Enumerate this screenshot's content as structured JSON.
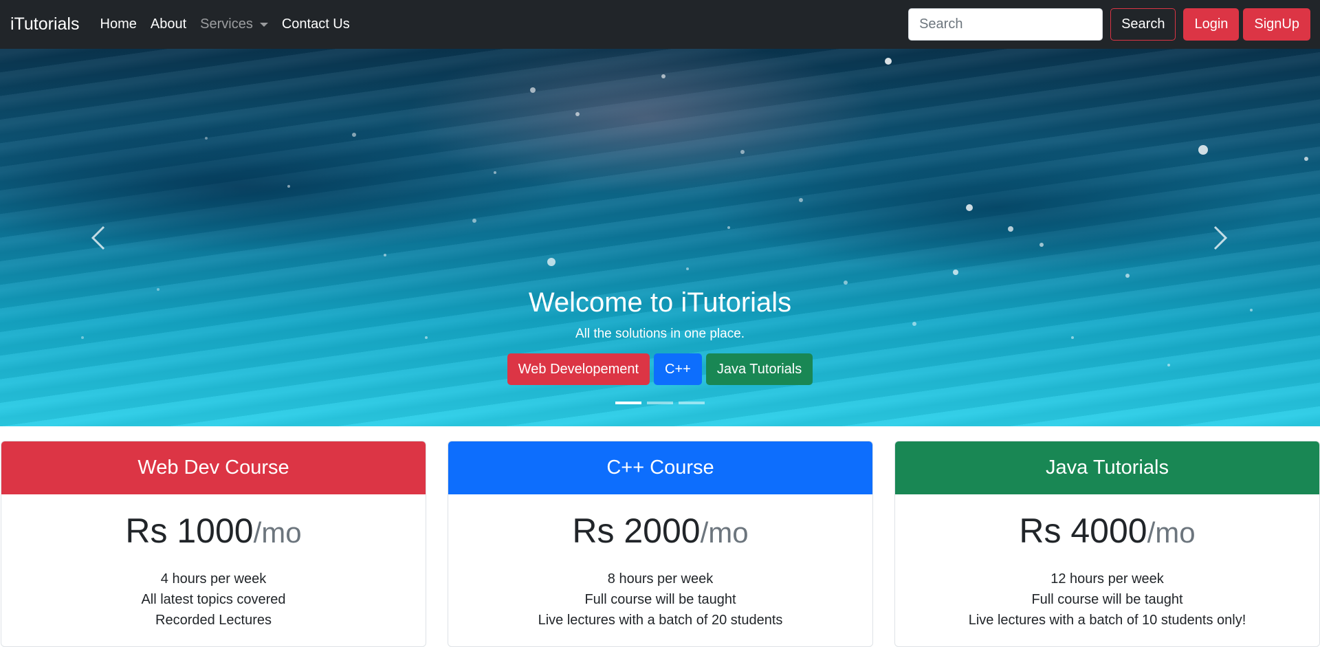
{
  "navbar": {
    "brand": "iTutorials",
    "links": [
      "Home",
      "About",
      "Services",
      "Contact Us"
    ],
    "search_placeholder": "Search",
    "search_button": "Search",
    "login_button": "Login",
    "signup_button": "SignUp"
  },
  "carousel": {
    "title": "Welcome to iTutorials",
    "subtitle": "All the solutions in one place.",
    "buttons": [
      "Web Developement",
      "C++",
      "Java Tutorials"
    ],
    "slide_count": 3,
    "active_slide": 1,
    "prev_icon": "chevron-left-icon",
    "next_icon": "chevron-right-icon"
  },
  "cards": [
    {
      "title": "Web Dev Course",
      "price": "Rs 1000",
      "period": "/mo",
      "color": "#dc3545",
      "features": [
        "4 hours per week",
        "All latest topics covered",
        "Recorded Lectures"
      ]
    },
    {
      "title": "C++ Course",
      "price": "Rs 2000",
      "period": "/mo",
      "color": "#0d6efd",
      "features": [
        "8 hours per week",
        "Full course will be taught",
        "Live lectures with a batch of 20 students"
      ]
    },
    {
      "title": "Java Tutorials",
      "price": "Rs 4000",
      "period": "/mo",
      "color": "#198754",
      "features": [
        "12 hours per week",
        "Full course will be taught",
        "Live lectures with a batch of 10 students only!"
      ]
    }
  ],
  "colors": {
    "navbar_bg": "#212529",
    "danger": "#dc3545",
    "primary": "#0d6efd",
    "success": "#198754"
  }
}
